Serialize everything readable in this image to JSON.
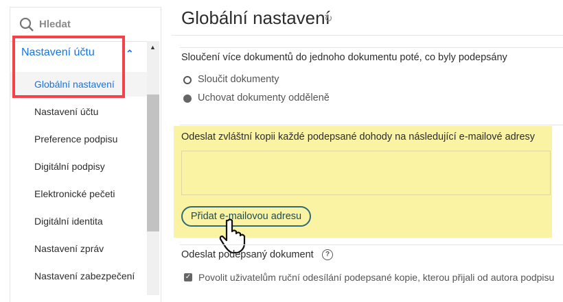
{
  "sidebar": {
    "search_placeholder": "Hledat",
    "section": "Nastavení účtu",
    "items": [
      {
        "label": "Globální nastavení",
        "active": true
      },
      {
        "label": "Nastavení účtu"
      },
      {
        "label": "Preference podpisu"
      },
      {
        "label": "Digitální podpisy"
      },
      {
        "label": "Elektronické pečeti"
      },
      {
        "label": "Digitální identita"
      },
      {
        "label": "Nastavení zpráv"
      },
      {
        "label": "Nastavení zabezpečení"
      }
    ]
  },
  "main": {
    "title": "Globální nastavení",
    "merge": {
      "heading": "Sloučení více dokumentů do jednoho dokumentu poté, co byly podepsány",
      "options": [
        {
          "label": "Sloučit dokumenty",
          "selected": false
        },
        {
          "label": "Uchovat dokumenty odděleně",
          "selected": true
        }
      ]
    },
    "copy": {
      "heading": "Odeslat zvláštní kopii každé podepsané dohody na následující e-mailové adresy",
      "emails_value": "",
      "add_button": "Přidat e-mailovou adresu"
    },
    "send": {
      "heading": "Odeslat podepsaný dokument",
      "help": "?",
      "checkbox_label": "Povolit uživatelům ruční odesílání podepsané kopie, kterou přijali od autora podpisu",
      "checked": true
    }
  },
  "colors": {
    "accent": "#1473e6",
    "highlight": "#faf3a4",
    "annotation": "#f5424a"
  }
}
